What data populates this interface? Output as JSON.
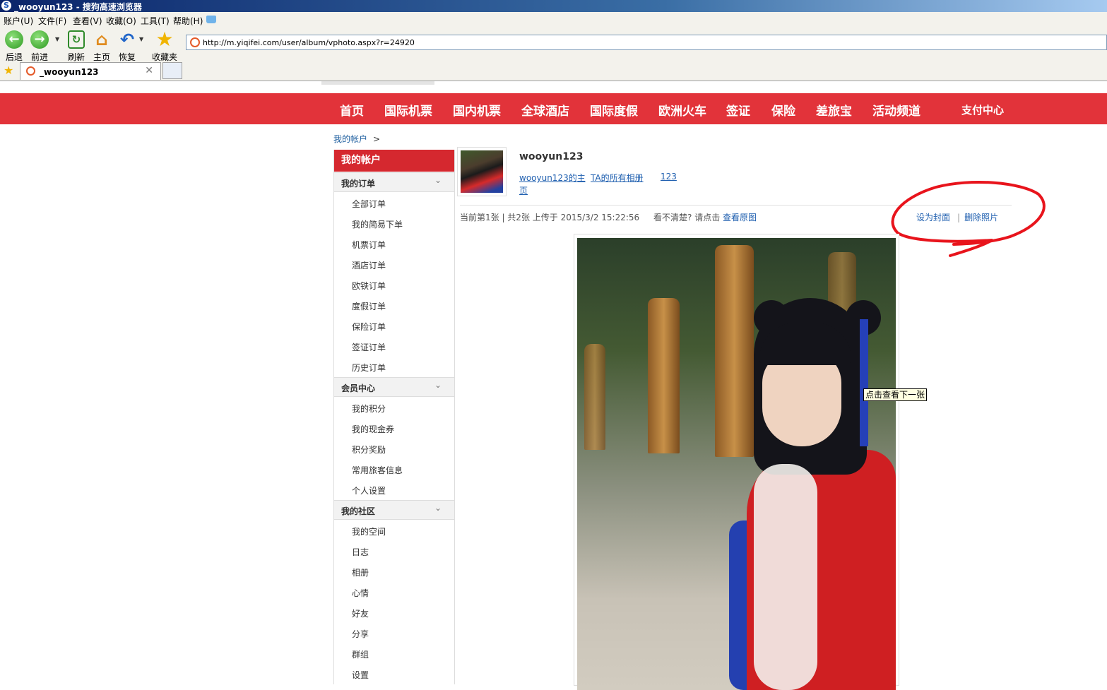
{
  "window": {
    "title": "_wooyun123 - 搜狗高速浏览器"
  },
  "menu": [
    "账户(U)",
    "文件(F)",
    "查看(V)",
    "收藏(O)",
    "工具(T)",
    "帮助(H)"
  ],
  "toolbar": {
    "back": "后退",
    "forward": "前进",
    "refresh": "刷新",
    "home": "主页",
    "restore": "恢复",
    "favorites": "收藏夹"
  },
  "address": {
    "url": "http://m.yiqifei.com/user/album/vphoto.aspx?r=24920"
  },
  "tabs": [
    {
      "title": "_wooyun123"
    }
  ],
  "nav": [
    "首页",
    "国际机票",
    "国内机票",
    "全球酒店",
    "国际度假",
    "欧洲火车",
    "签证",
    "保险",
    "差旅宝",
    "活动频道",
    "支付中心"
  ],
  "breadcrumb": {
    "root": "我的帐户",
    "sep": ">"
  },
  "sidebar": {
    "header": "我的帐户",
    "sections": [
      {
        "title": "我的订单",
        "items": [
          "全部订单",
          "我的简易下单",
          "机票订单",
          "酒店订单",
          "欧铁订单",
          "度假订单",
          "保险订单",
          "签证订单",
          "历史订单"
        ]
      },
      {
        "title": "会员中心",
        "items": [
          "我的积分",
          "我的现金券",
          "积分奖励",
          "常用旅客信息",
          "个人设置"
        ]
      },
      {
        "title": "我的社区",
        "items": [
          "我的空间",
          "日志",
          "相册",
          "心情",
          "好友",
          "分享",
          "群组",
          "设置"
        ]
      }
    ]
  },
  "profile": {
    "username": "wooyun123",
    "home_link_1": "wooyun123的主",
    "home_link_2": "页",
    "albums_link": "TA的所有相册",
    "album_name": "123"
  },
  "photo_info": {
    "text": "当前第1张 | 共2张 上传于 2015/3/2 15:22:56",
    "unclear": "看不清楚? 请点击",
    "view_original": "查看原图",
    "set_cover": "设为封面",
    "separator": "|",
    "delete": "删除照片"
  },
  "tooltip": "点击查看下一张",
  "colors": {
    "nav_red": "#e2333a",
    "link_blue": "#2060b0",
    "annotation_red": "#e8141c"
  }
}
